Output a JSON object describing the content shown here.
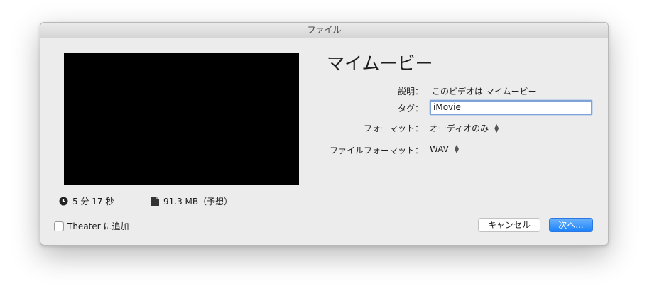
{
  "window": {
    "title": "ファイル"
  },
  "movie": {
    "title": "マイムービー",
    "duration": "5 分 17 秒",
    "size": "91.3 MB（予想）"
  },
  "fields": {
    "description_label": "説明：",
    "description_value": "このビデオは マイムービー",
    "tag_label": "タグ：",
    "tag_value": "iMovie",
    "format_label": "フォーマット：",
    "format_value": "オーディオのみ",
    "file_format_label": "ファイルフォーマット：",
    "file_format_value": "WAV"
  },
  "theater_checkbox": {
    "label": "Theater に追加",
    "checked": false
  },
  "buttons": {
    "cancel": "キャンセル",
    "next": "次へ..."
  },
  "colors": {
    "accent": "#1a82fb",
    "focus_ring": "#7ea3d4"
  },
  "icons": {
    "duration": "clock-icon",
    "size": "document-icon",
    "stepper": "up-down-arrows-icon"
  }
}
